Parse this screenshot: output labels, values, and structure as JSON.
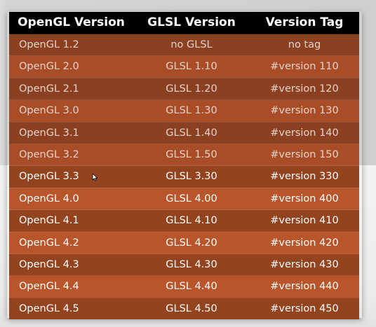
{
  "table": {
    "headers": [
      "OpenGL Version",
      "GLSL Version",
      "Version Tag"
    ],
    "rows": [
      {
        "opengl": "OpenGL 1.2",
        "glsl": "no GLSL",
        "tag": "no tag"
      },
      {
        "opengl": "OpenGL 2.0",
        "glsl": "GLSL 1.10",
        "tag": "#version 110"
      },
      {
        "opengl": "OpenGL 2.1",
        "glsl": "GLSL 1.20",
        "tag": "#version 120"
      },
      {
        "opengl": "OpenGL 3.0",
        "glsl": "GLSL 1.30",
        "tag": "#version 130"
      },
      {
        "opengl": "OpenGL 3.1",
        "glsl": "GLSL 1.40",
        "tag": "#version 140"
      },
      {
        "opengl": "OpenGL 3.2",
        "glsl": "GLSL 1.50",
        "tag": "#version 150"
      },
      {
        "opengl": "OpenGL 3.3",
        "glsl": "GLSL 3.30",
        "tag": "#version 330"
      },
      {
        "opengl": "OpenGL 4.0",
        "glsl": "GLSL 4.00",
        "tag": "#version 400"
      },
      {
        "opengl": "OpenGL 4.1",
        "glsl": "GLSL 4.10",
        "tag": "#version 410"
      },
      {
        "opengl": "OpenGL 4.2",
        "glsl": "GLSL 4.20",
        "tag": "#version 420"
      },
      {
        "opengl": "OpenGL 4.3",
        "glsl": "GLSL 4.30",
        "tag": "#version 430"
      },
      {
        "opengl": "OpenGL 4.4",
        "glsl": "GLSL 4.40",
        "tag": "#version 440"
      },
      {
        "opengl": "OpenGL 4.5",
        "glsl": "GLSL 4.50",
        "tag": "#version 450"
      }
    ]
  },
  "colors": {
    "header_bg": "#000000",
    "row_dark": "#8a4021",
    "row_light": "#a94d28",
    "text": "#ffffff"
  },
  "icons": {
    "cursor": "mouse-pointer-icon"
  }
}
